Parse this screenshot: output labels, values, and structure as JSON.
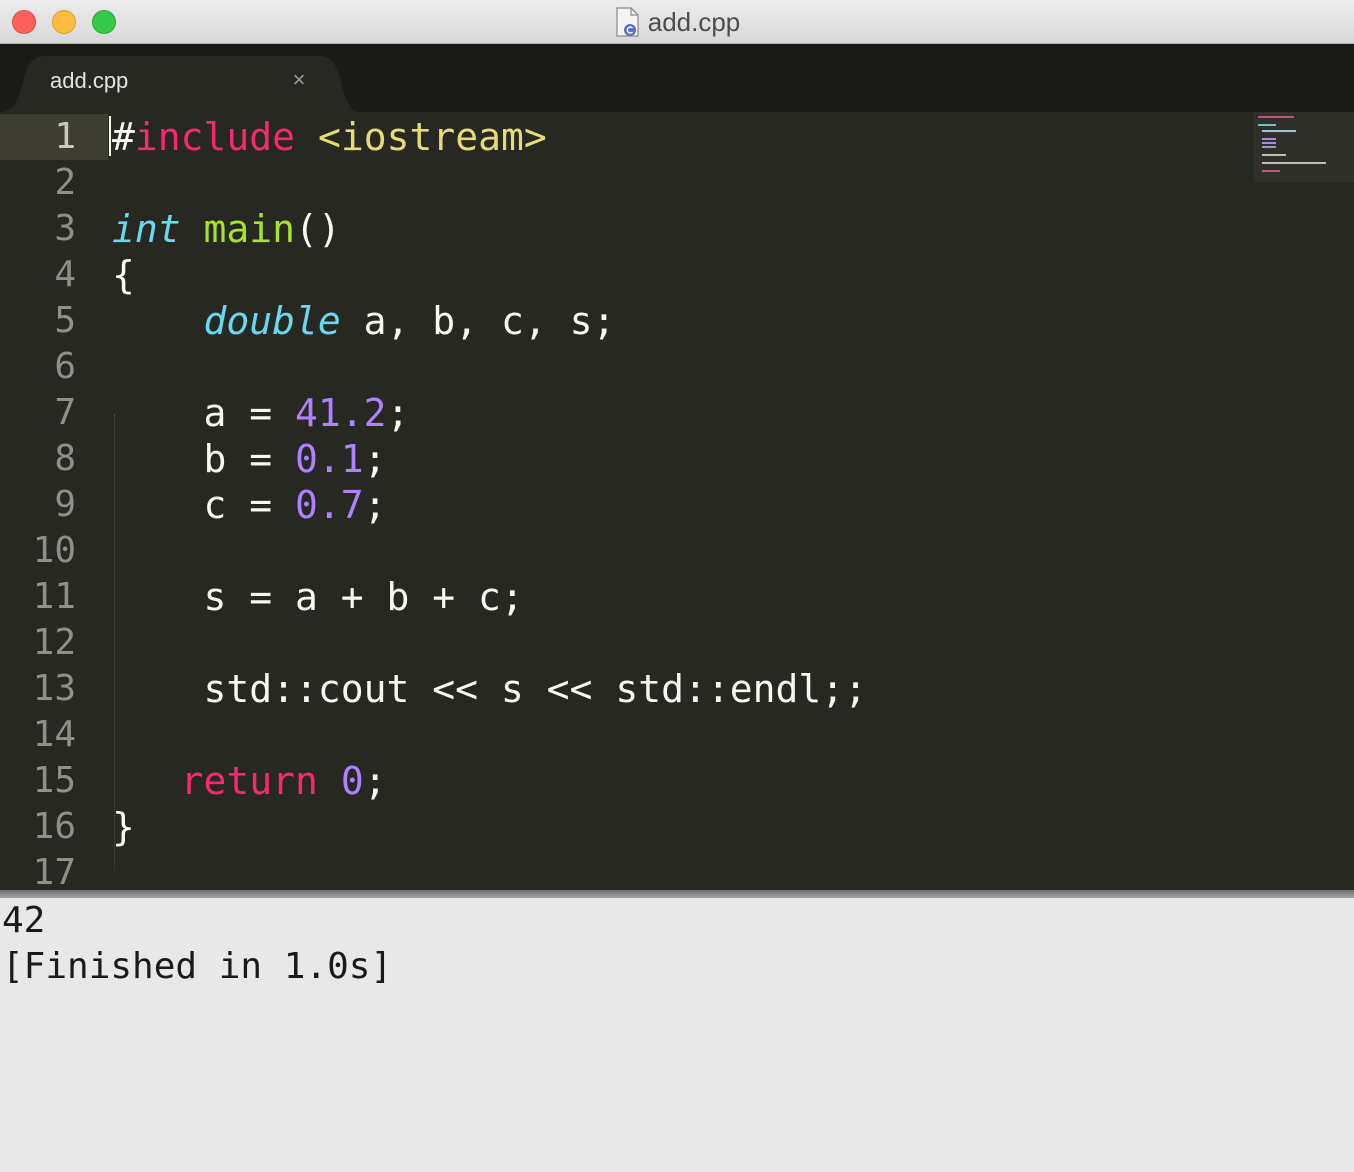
{
  "window": {
    "title": "add.cpp"
  },
  "tabs": [
    {
      "label": "add.cpp",
      "close_glyph": "×",
      "active": true
    }
  ],
  "editor": {
    "line_numbers": [
      "1",
      "2",
      "3",
      "4",
      "5",
      "6",
      "7",
      "8",
      "9",
      "10",
      "11",
      "12",
      "13",
      "14",
      "15",
      "16",
      "17"
    ],
    "active_line": 1,
    "lines": {
      "l1": {
        "hash": "#",
        "include": "include",
        "sp": " ",
        "header": "<iostream>"
      },
      "l3": {
        "type": "int",
        "sp": " ",
        "func": "main",
        "rest": "()"
      },
      "l4": {
        "text": "{"
      },
      "l5": {
        "indent": "    ",
        "type": "double",
        "rest": " a, b, c, s;"
      },
      "l7": {
        "indent": "    ",
        "pre": "a = ",
        "num": "41.2",
        "post": ";"
      },
      "l8": {
        "indent": "    ",
        "pre": "b = ",
        "num": "0.1",
        "post": ";"
      },
      "l9": {
        "indent": "    ",
        "pre": "c = ",
        "num": "0.7",
        "post": ";"
      },
      "l11": {
        "text": "    s = a + b + c;"
      },
      "l13": {
        "text": "    std::cout << s << std::endl;;"
      },
      "l15": {
        "indent": "   ",
        "kw": "return",
        "sp": " ",
        "num": "0",
        "post": ";"
      },
      "l16": {
        "text": "}"
      }
    }
  },
  "output": {
    "lines": [
      "42",
      "[Finished in 1.0s]"
    ]
  },
  "colors": {
    "editor_bg": "#272822",
    "keyword": "#f92672",
    "type": "#66d9ef",
    "function": "#a6e22e",
    "string": "#e6db74",
    "number": "#ae81ff",
    "output_bg": "#e8e8e8"
  }
}
